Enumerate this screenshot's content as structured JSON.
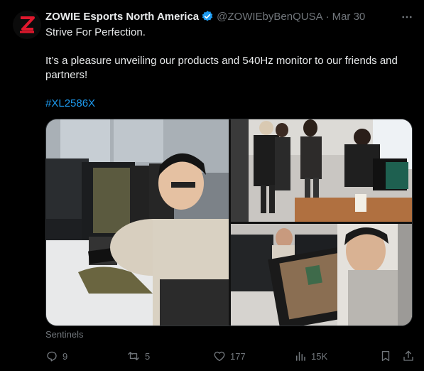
{
  "tweet": {
    "author": {
      "name": "ZOWIE Esports North America",
      "handle": "@ZOWIEbyBenQUSA",
      "separator": "·",
      "date": "Mar 30",
      "avatar_icon": "zowie-logo-icon",
      "verified_icon": "verified-badge-icon"
    },
    "text": {
      "line1": "Strive For Perfection.",
      "line2": "It’s a pleasure unveiling our products and 540Hz monitor to our friends and partners!",
      "hashtag": "#XL2586X"
    },
    "media": {
      "count": 3
    },
    "tagged": "Sentinels",
    "actions": {
      "replies": "9",
      "retweets": "5",
      "likes": "177",
      "views": "15K"
    }
  },
  "colors": {
    "background": "#000000",
    "text": "#e7e9ea",
    "muted": "#71767b",
    "link": "#1d9bf0",
    "brand_red": "#e0182d",
    "verified": "#1d9bf0"
  }
}
